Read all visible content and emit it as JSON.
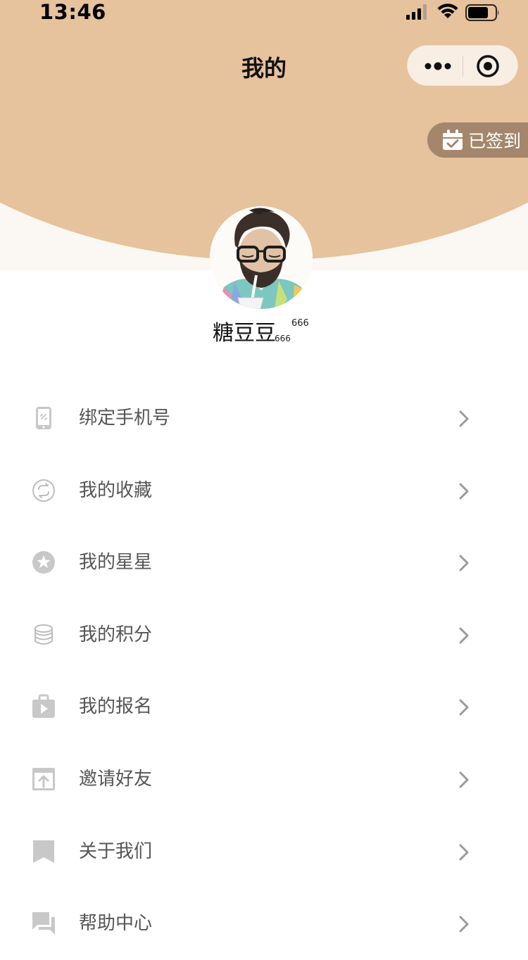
{
  "status_bar": {
    "time": "13:46"
  },
  "nav": {
    "title": "我的"
  },
  "signin": {
    "label": "已签到"
  },
  "user": {
    "name": "糖豆豆",
    "sup_number": "666",
    "sub_number": "666"
  },
  "menu": {
    "items": [
      {
        "label": "绑定手机号",
        "icon": "phone-icon"
      },
      {
        "label": "我的收藏",
        "icon": "refresh-circle-icon"
      },
      {
        "label": "我的星星",
        "icon": "star-circle-icon"
      },
      {
        "label": "我的积分",
        "icon": "coins-icon"
      },
      {
        "label": "我的报名",
        "icon": "play-bag-icon"
      },
      {
        "label": "邀请好友",
        "icon": "share-upload-icon"
      },
      {
        "label": "关于我们",
        "icon": "bookmark-icon"
      },
      {
        "label": "帮助中心",
        "icon": "chat-icon"
      }
    ]
  },
  "colors": {
    "header": "#e6c29d",
    "signin_badge": "#a3866b",
    "icon_gray": "#c8c8c8"
  }
}
